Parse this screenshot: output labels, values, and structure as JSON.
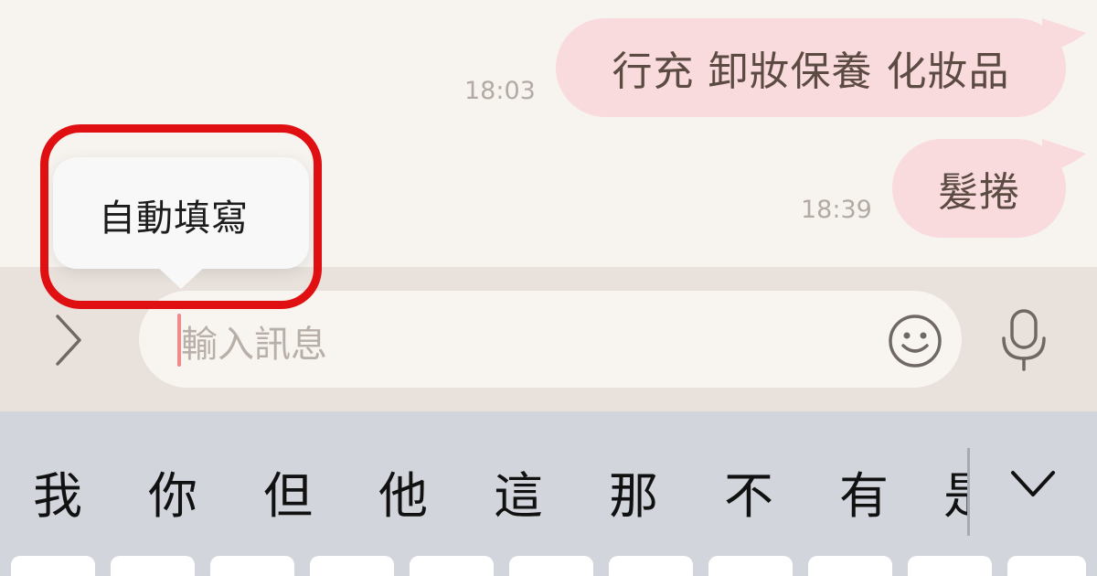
{
  "messages": [
    {
      "text": "行充 卸妝保養 化妝品",
      "time": "18:03"
    },
    {
      "text": "髮捲",
      "time": "18:39"
    }
  ],
  "popup": {
    "label": "自動填寫"
  },
  "input": {
    "placeholder": "輸入訊息"
  },
  "icons": {
    "expand": "chevron-right-icon",
    "emoji": "smiley-icon",
    "mic": "microphone-icon",
    "collapse": "chevron-down-icon"
  },
  "keyboard": {
    "suggestions": [
      "我",
      "你",
      "但",
      "他",
      "這",
      "那",
      "不",
      "有",
      "是"
    ]
  },
  "colors": {
    "bubble": "#f9dadd",
    "chat_bg": "#f7f4ef",
    "input_bar_bg": "#e9e2dc",
    "keyboard_bg": "#d2d5dc",
    "highlight": "#e00f12",
    "caret": "#f18b8b"
  }
}
